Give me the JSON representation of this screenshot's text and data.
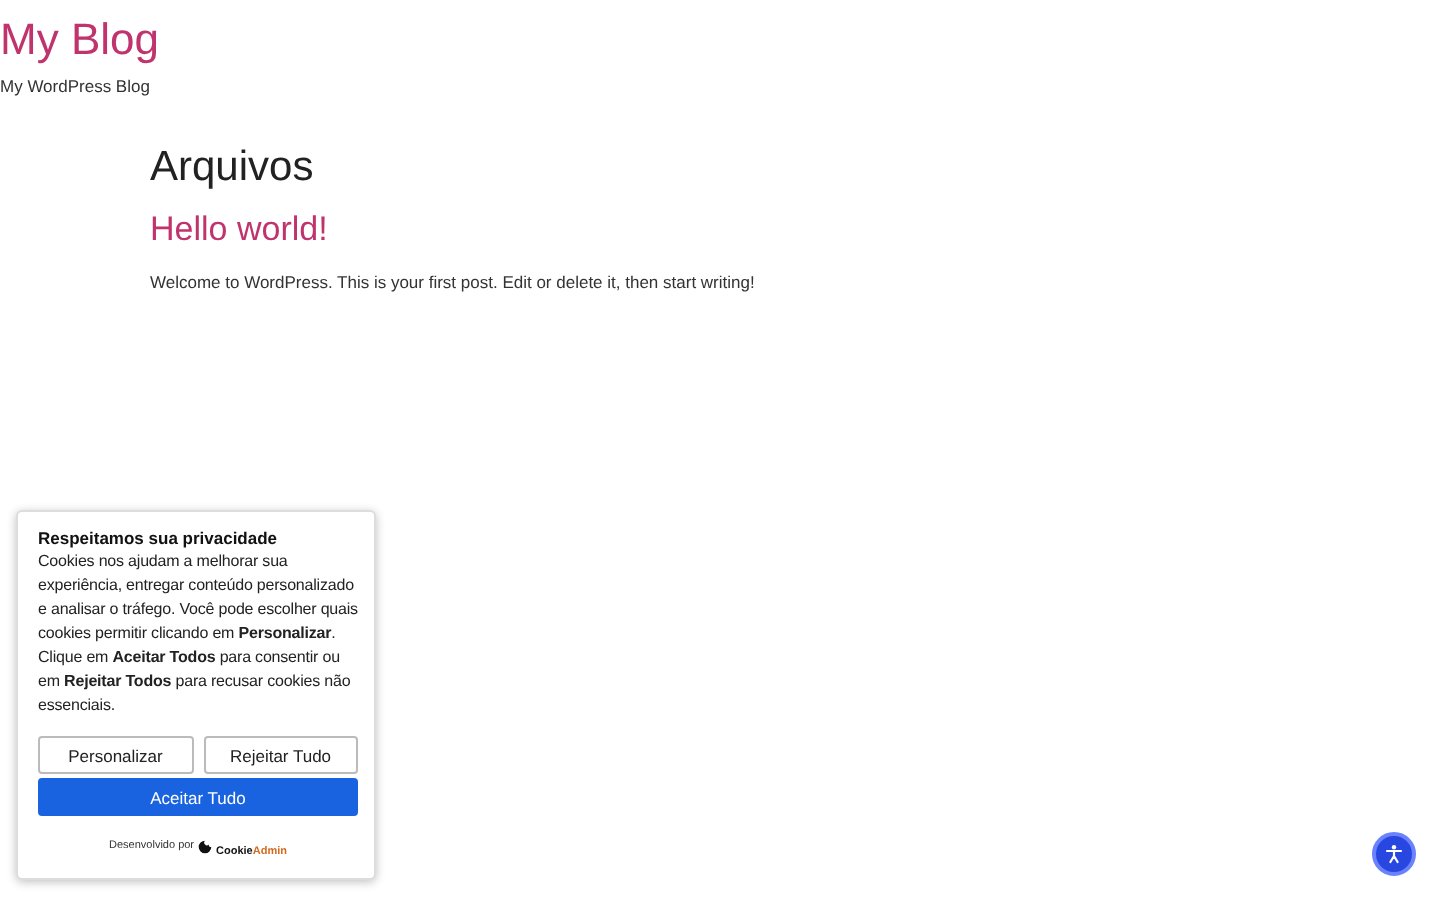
{
  "site": {
    "title": "My Blog",
    "tagline": "My WordPress Blog"
  },
  "archive": {
    "heading": "Arquivos",
    "posts": [
      {
        "title": "Hello world!",
        "excerpt": "Welcome to WordPress. This is your first post. Edit or delete it, then start writing!"
      }
    ]
  },
  "cookie_banner": {
    "title": "Respeitamos sua privacidade",
    "body": "Cookies nos ajudam a melhorar sua experiência, entregar conteúdo personalizado e analisar o tráfego. Você pode escolher quais cookies permitir clicando em **Personalizar**. Clique em **Aceitar Todos** para consentir ou em **Rejeitar Todos** para recusar cookies não essenciais.",
    "buttons": [
      {
        "label": "Personalizar",
        "kind": "secondary"
      },
      {
        "label": "Rejeitar Tudo",
        "kind": "secondary"
      },
      {
        "label": "Aceitar Tudo",
        "kind": "primary"
      }
    ],
    "footer": {
      "text": "Desenvolvido por",
      "brand_part_1": "Cookie",
      "brand_part_2": "Admin"
    }
  }
}
